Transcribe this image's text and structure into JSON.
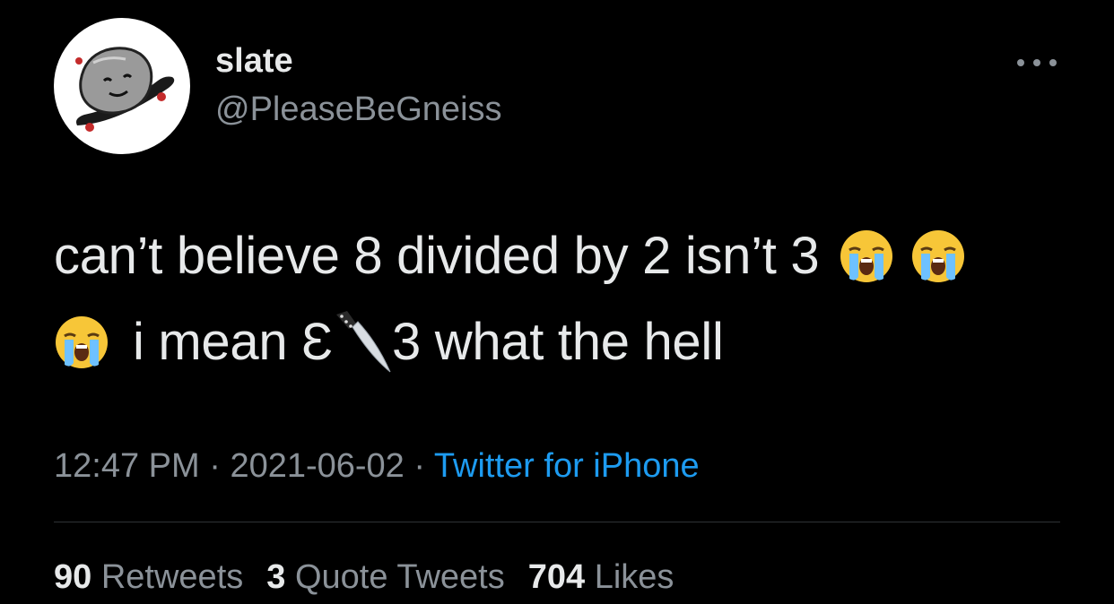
{
  "user": {
    "display_name": "slate",
    "handle": "@PleaseBeGneiss",
    "avatar_icon": "rock-on-skateboard-avatar"
  },
  "menu": {
    "icon": "more-horizontal-icon"
  },
  "tweet": {
    "line1_text": "can’t believe 8 divided by 2 isn’t 3",
    "line2_pre": "i mean",
    "line2_eps": "Ɛ",
    "line2_post": "3 what the hell",
    "emojis": [
      "loudly-crying-face",
      "loudly-crying-face",
      "loudly-crying-face",
      "kitchen-knife"
    ]
  },
  "meta": {
    "time": "12:47 PM",
    "separator": " · ",
    "date": "2021-06-02",
    "source": "Twitter for iPhone"
  },
  "stats": {
    "retweets_count": "90",
    "retweets_label": "Retweets",
    "quotes_count": "3",
    "quotes_label": "Quote Tweets",
    "likes_count": "704",
    "likes_label": "Likes"
  },
  "colors": {
    "background": "#000000",
    "primary_text": "#e7e9ea",
    "secondary_text": "#8b9299",
    "link": "#1d9bf0",
    "divider": "#2f3336"
  }
}
